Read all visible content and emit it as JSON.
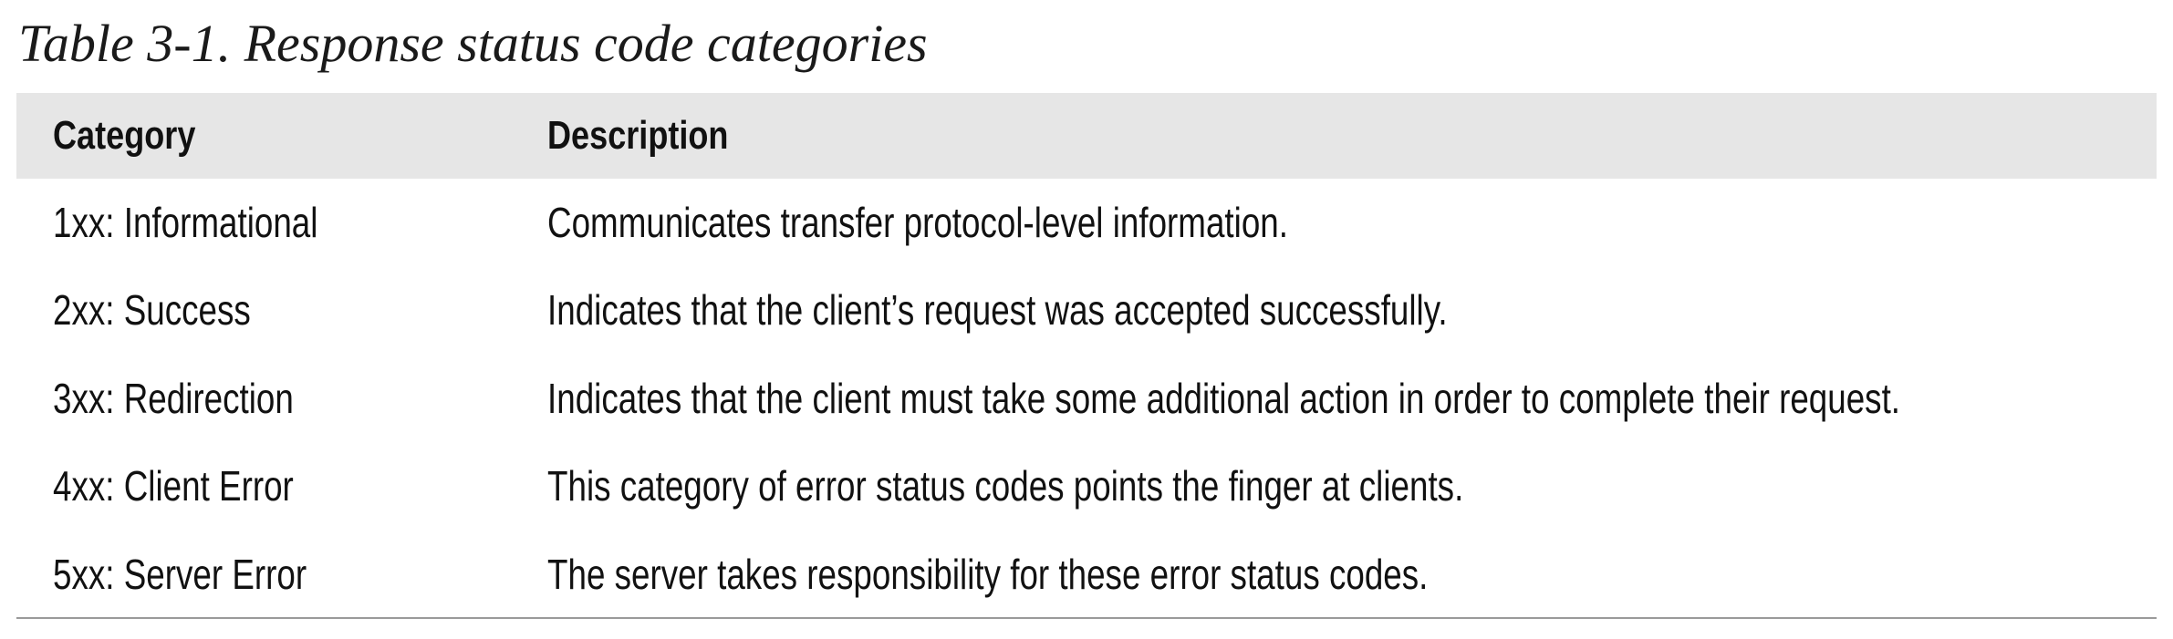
{
  "caption": "Table 3-1. Response status code categories",
  "table": {
    "headers": {
      "category": "Category",
      "description": "Description"
    },
    "rows": [
      {
        "category": "1xx: Informational",
        "description": "Communicates transfer protocol-level information."
      },
      {
        "category": "2xx: Success",
        "description": "Indicates that the client’s request was accepted successfully."
      },
      {
        "category": "3xx: Redirection",
        "description": "Indicates that the client must take some additional action in order to complete their request."
      },
      {
        "category": "4xx: Client Error",
        "description": "This category of error status codes points the finger at clients."
      },
      {
        "category": "5xx: Server Error",
        "description": "The server takes responsibility for these error status codes."
      }
    ]
  },
  "colors": {
    "header_background": "#e6e6e6",
    "rule": "#9a9a9a",
    "text": "#111111"
  }
}
